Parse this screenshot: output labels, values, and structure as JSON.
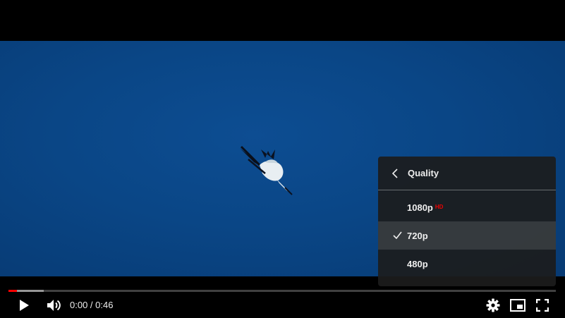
{
  "player": {
    "time": {
      "current": "0:00",
      "separator": " / ",
      "duration": "0:46"
    },
    "progress": {
      "played_fraction": 0.015,
      "buffered_fraction": 0.064
    }
  },
  "quality_menu": {
    "title": "Quality",
    "items": [
      {
        "label": "1080p",
        "badge": "HD",
        "selected": false
      },
      {
        "label": "720p",
        "badge": "",
        "selected": true
      },
      {
        "label": "480p",
        "badge": "",
        "selected": false
      }
    ]
  },
  "icons": {
    "play": "play-icon",
    "volume": "volume-icon",
    "settings": "gear-icon",
    "miniplayer": "miniplayer-icon",
    "fullscreen": "fullscreen-icon",
    "back": "chevron-left-icon",
    "check": "check-icon"
  },
  "colors": {
    "accent": "#ff0000",
    "hd_badge": "#e00000",
    "sky": "#0a4686"
  }
}
